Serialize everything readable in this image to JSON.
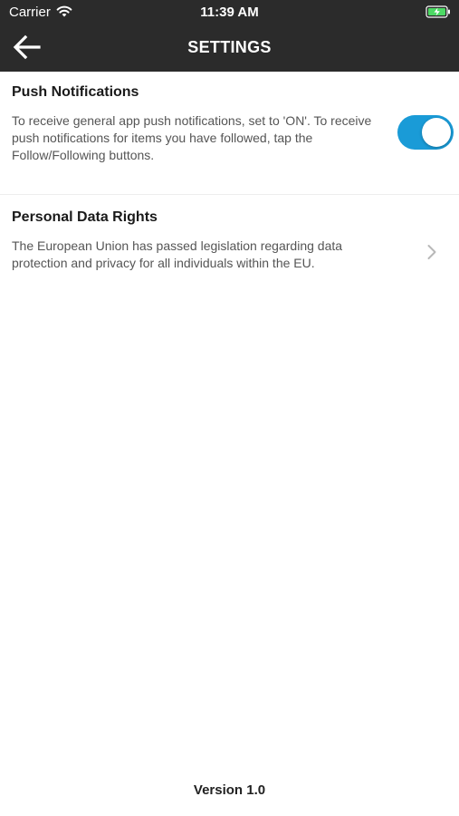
{
  "status_bar": {
    "carrier": "Carrier",
    "time": "11:39 AM",
    "wifi_icon": "wifi-icon",
    "battery_icon": "battery-charging-icon"
  },
  "nav": {
    "title": "SETTINGS",
    "back_icon": "back-arrow-icon"
  },
  "push_notifications": {
    "title": "Push Notifications",
    "description": "To receive general app push notifications, set to 'ON'. To receive push notifications for items you have followed, tap the Follow/Following buttons.",
    "toggle_on": true
  },
  "personal_data_rights": {
    "title": "Personal Data Rights",
    "description": "The European Union has passed legislation regarding data protection and privacy for all individuals within the EU.",
    "chevron_icon": "chevron-right-icon"
  },
  "footer": {
    "version": "Version 1.0"
  },
  "colors": {
    "header_bg": "#2b2b2b",
    "toggle_on": "#1a9bd7",
    "battery_green": "#4cd964"
  }
}
